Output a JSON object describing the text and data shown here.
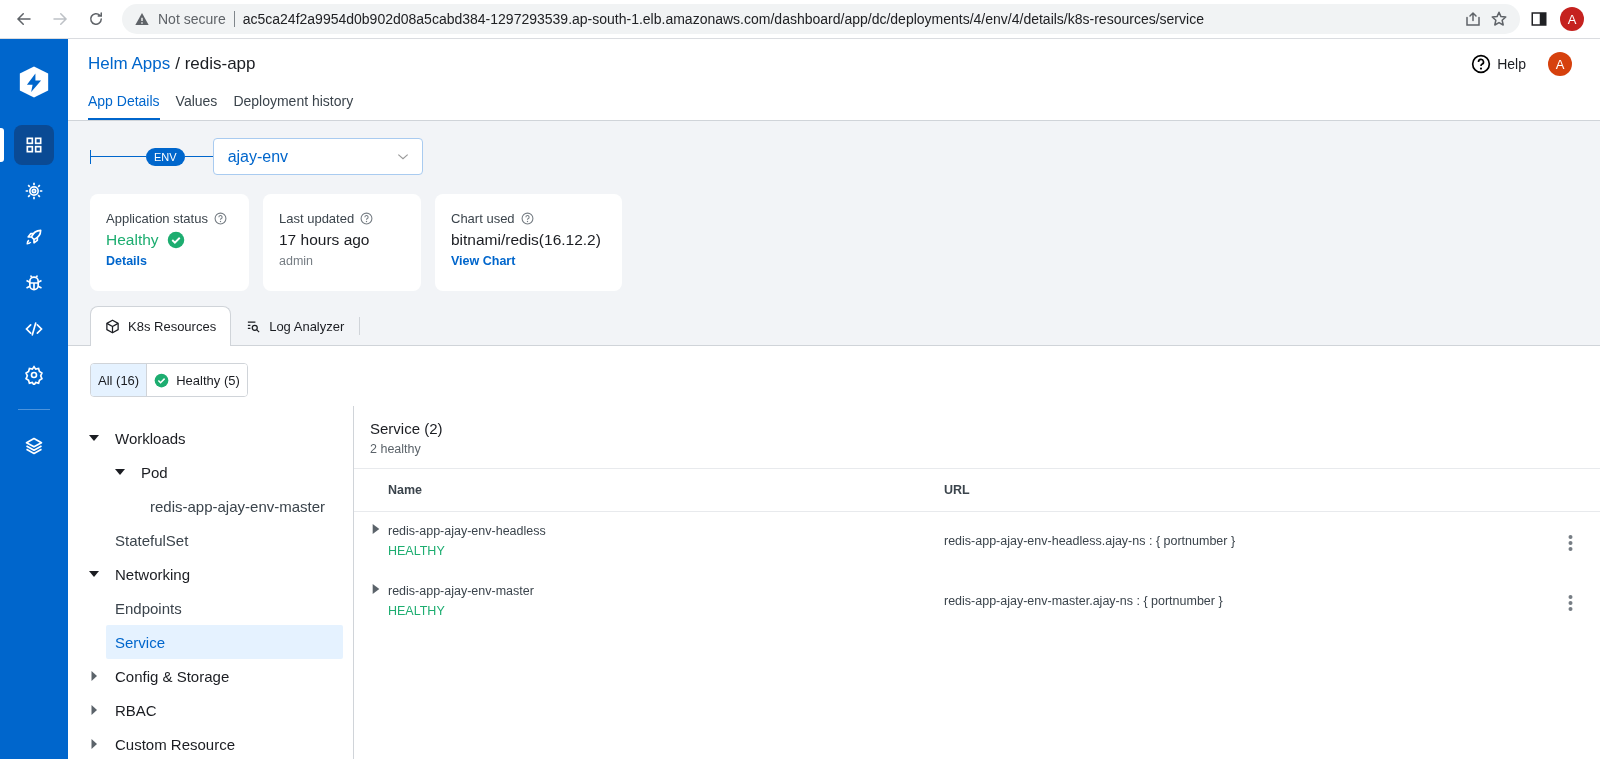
{
  "browser": {
    "security": "Not secure",
    "url": "ac5ca24f2a9954d0b902d08a5cabd384-1297293539.ap-south-1.elb.amazonaws.com/dashboard/app/dc/deployments/4/env/4/details/k8s-resources/service",
    "avatar": "A"
  },
  "sidebar": {
    "items": [
      {
        "kind": "grid",
        "selected": true
      },
      {
        "kind": "gear-sun",
        "selected": false
      },
      {
        "kind": "rocket",
        "selected": false
      },
      {
        "kind": "bug",
        "selected": false
      },
      {
        "kind": "code",
        "selected": false
      },
      {
        "kind": "settings",
        "selected": false
      },
      {
        "kind": "divider"
      },
      {
        "kind": "stack",
        "selected": false
      }
    ]
  },
  "header": {
    "breadcrumb_parent": "Helm Apps",
    "breadcrumb_current": "/ redis-app",
    "help": "Help",
    "avatar": "A",
    "tabs": [
      {
        "label": "App Details",
        "selected": true
      },
      {
        "label": "Values",
        "selected": false
      },
      {
        "label": "Deployment history",
        "selected": false
      }
    ]
  },
  "environment": {
    "badge": "ENV",
    "value": "ajay-env"
  },
  "cards": [
    {
      "title": "Application status",
      "kind": "status",
      "value": "Healthy",
      "footer": {
        "kind": "link",
        "text": "Details"
      }
    },
    {
      "title": "Last updated",
      "kind": "plain",
      "value": "17 hours ago",
      "footer": {
        "kind": "plain",
        "text": "admin"
      }
    },
    {
      "title": "Chart used",
      "kind": "plain",
      "value": "bitnami/redis(16.12.2)",
      "footer": {
        "kind": "link",
        "text": "View Chart"
      }
    }
  ],
  "resource_tabs": [
    {
      "label": "K8s Resources",
      "kind": "cube",
      "selected": true
    },
    {
      "label": "Log Analyzer",
      "kind": "log",
      "selected": false
    }
  ],
  "filters": [
    {
      "label": "All (16)",
      "kind": "all",
      "selected": true
    },
    {
      "label": "Healthy (5)",
      "kind": "healthy",
      "selected": false
    }
  ],
  "tree": [
    {
      "label": "Workloads",
      "expanded": true,
      "children": [
        {
          "label": "Pod",
          "expanded": true,
          "children": [
            {
              "label": "redis-app-ajay-env-master",
              "selected": false
            }
          ]
        },
        {
          "label": "StatefulSet",
          "selected": false
        }
      ]
    },
    {
      "label": "Networking",
      "expanded": true,
      "children": [
        {
          "label": "Endpoints",
          "selected": false
        },
        {
          "label": "Service",
          "selected": true
        }
      ]
    },
    {
      "label": "Config & Storage",
      "expanded": false
    },
    {
      "label": "RBAC",
      "expanded": false
    },
    {
      "label": "Custom Resource",
      "expanded": false
    }
  ],
  "panel": {
    "title": "Service (2)",
    "subtitle": "2 healthy",
    "columns": [
      "Name",
      "URL"
    ],
    "rows": [
      {
        "name": "redis-app-ajay-env-headless",
        "status": "HEALTHY",
        "url": "redis-app-ajay-env-headless.ajay-ns : { portnumber }"
      },
      {
        "name": "redis-app-ajay-env-master",
        "status": "HEALTHY",
        "url": "redis-app-ajay-env-master.ajay-ns : { portnumber }"
      }
    ]
  }
}
